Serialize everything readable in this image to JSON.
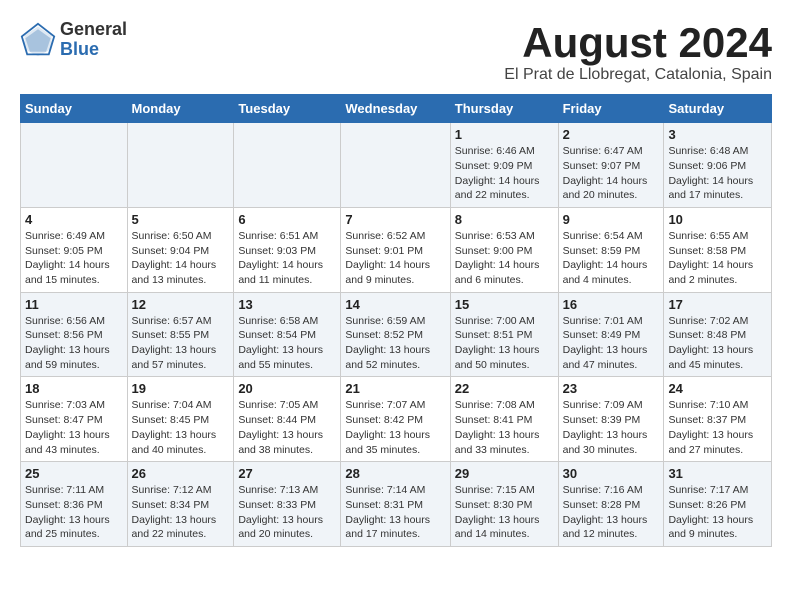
{
  "logo": {
    "general": "General",
    "blue": "Blue"
  },
  "title": "August 2024",
  "subtitle": "El Prat de Llobregat, Catalonia, Spain",
  "headers": [
    "Sunday",
    "Monday",
    "Tuesday",
    "Wednesday",
    "Thursday",
    "Friday",
    "Saturday"
  ],
  "weeks": [
    [
      {
        "day": "",
        "info": ""
      },
      {
        "day": "",
        "info": ""
      },
      {
        "day": "",
        "info": ""
      },
      {
        "day": "",
        "info": ""
      },
      {
        "day": "1",
        "info": "Sunrise: 6:46 AM\nSunset: 9:09 PM\nDaylight: 14 hours\nand 22 minutes."
      },
      {
        "day": "2",
        "info": "Sunrise: 6:47 AM\nSunset: 9:07 PM\nDaylight: 14 hours\nand 20 minutes."
      },
      {
        "day": "3",
        "info": "Sunrise: 6:48 AM\nSunset: 9:06 PM\nDaylight: 14 hours\nand 17 minutes."
      }
    ],
    [
      {
        "day": "4",
        "info": "Sunrise: 6:49 AM\nSunset: 9:05 PM\nDaylight: 14 hours\nand 15 minutes."
      },
      {
        "day": "5",
        "info": "Sunrise: 6:50 AM\nSunset: 9:04 PM\nDaylight: 14 hours\nand 13 minutes."
      },
      {
        "day": "6",
        "info": "Sunrise: 6:51 AM\nSunset: 9:03 PM\nDaylight: 14 hours\nand 11 minutes."
      },
      {
        "day": "7",
        "info": "Sunrise: 6:52 AM\nSunset: 9:01 PM\nDaylight: 14 hours\nand 9 minutes."
      },
      {
        "day": "8",
        "info": "Sunrise: 6:53 AM\nSunset: 9:00 PM\nDaylight: 14 hours\nand 6 minutes."
      },
      {
        "day": "9",
        "info": "Sunrise: 6:54 AM\nSunset: 8:59 PM\nDaylight: 14 hours\nand 4 minutes."
      },
      {
        "day": "10",
        "info": "Sunrise: 6:55 AM\nSunset: 8:58 PM\nDaylight: 14 hours\nand 2 minutes."
      }
    ],
    [
      {
        "day": "11",
        "info": "Sunrise: 6:56 AM\nSunset: 8:56 PM\nDaylight: 13 hours\nand 59 minutes."
      },
      {
        "day": "12",
        "info": "Sunrise: 6:57 AM\nSunset: 8:55 PM\nDaylight: 13 hours\nand 57 minutes."
      },
      {
        "day": "13",
        "info": "Sunrise: 6:58 AM\nSunset: 8:54 PM\nDaylight: 13 hours\nand 55 minutes."
      },
      {
        "day": "14",
        "info": "Sunrise: 6:59 AM\nSunset: 8:52 PM\nDaylight: 13 hours\nand 52 minutes."
      },
      {
        "day": "15",
        "info": "Sunrise: 7:00 AM\nSunset: 8:51 PM\nDaylight: 13 hours\nand 50 minutes."
      },
      {
        "day": "16",
        "info": "Sunrise: 7:01 AM\nSunset: 8:49 PM\nDaylight: 13 hours\nand 47 minutes."
      },
      {
        "day": "17",
        "info": "Sunrise: 7:02 AM\nSunset: 8:48 PM\nDaylight: 13 hours\nand 45 minutes."
      }
    ],
    [
      {
        "day": "18",
        "info": "Sunrise: 7:03 AM\nSunset: 8:47 PM\nDaylight: 13 hours\nand 43 minutes."
      },
      {
        "day": "19",
        "info": "Sunrise: 7:04 AM\nSunset: 8:45 PM\nDaylight: 13 hours\nand 40 minutes."
      },
      {
        "day": "20",
        "info": "Sunrise: 7:05 AM\nSunset: 8:44 PM\nDaylight: 13 hours\nand 38 minutes."
      },
      {
        "day": "21",
        "info": "Sunrise: 7:07 AM\nSunset: 8:42 PM\nDaylight: 13 hours\nand 35 minutes."
      },
      {
        "day": "22",
        "info": "Sunrise: 7:08 AM\nSunset: 8:41 PM\nDaylight: 13 hours\nand 33 minutes."
      },
      {
        "day": "23",
        "info": "Sunrise: 7:09 AM\nSunset: 8:39 PM\nDaylight: 13 hours\nand 30 minutes."
      },
      {
        "day": "24",
        "info": "Sunrise: 7:10 AM\nSunset: 8:37 PM\nDaylight: 13 hours\nand 27 minutes."
      }
    ],
    [
      {
        "day": "25",
        "info": "Sunrise: 7:11 AM\nSunset: 8:36 PM\nDaylight: 13 hours\nand 25 minutes."
      },
      {
        "day": "26",
        "info": "Sunrise: 7:12 AM\nSunset: 8:34 PM\nDaylight: 13 hours\nand 22 minutes."
      },
      {
        "day": "27",
        "info": "Sunrise: 7:13 AM\nSunset: 8:33 PM\nDaylight: 13 hours\nand 20 minutes."
      },
      {
        "day": "28",
        "info": "Sunrise: 7:14 AM\nSunset: 8:31 PM\nDaylight: 13 hours\nand 17 minutes."
      },
      {
        "day": "29",
        "info": "Sunrise: 7:15 AM\nSunset: 8:30 PM\nDaylight: 13 hours\nand 14 minutes."
      },
      {
        "day": "30",
        "info": "Sunrise: 7:16 AM\nSunset: 8:28 PM\nDaylight: 13 hours\nand 12 minutes."
      },
      {
        "day": "31",
        "info": "Sunrise: 7:17 AM\nSunset: 8:26 PM\nDaylight: 13 hours\nand 9 minutes."
      }
    ]
  ]
}
